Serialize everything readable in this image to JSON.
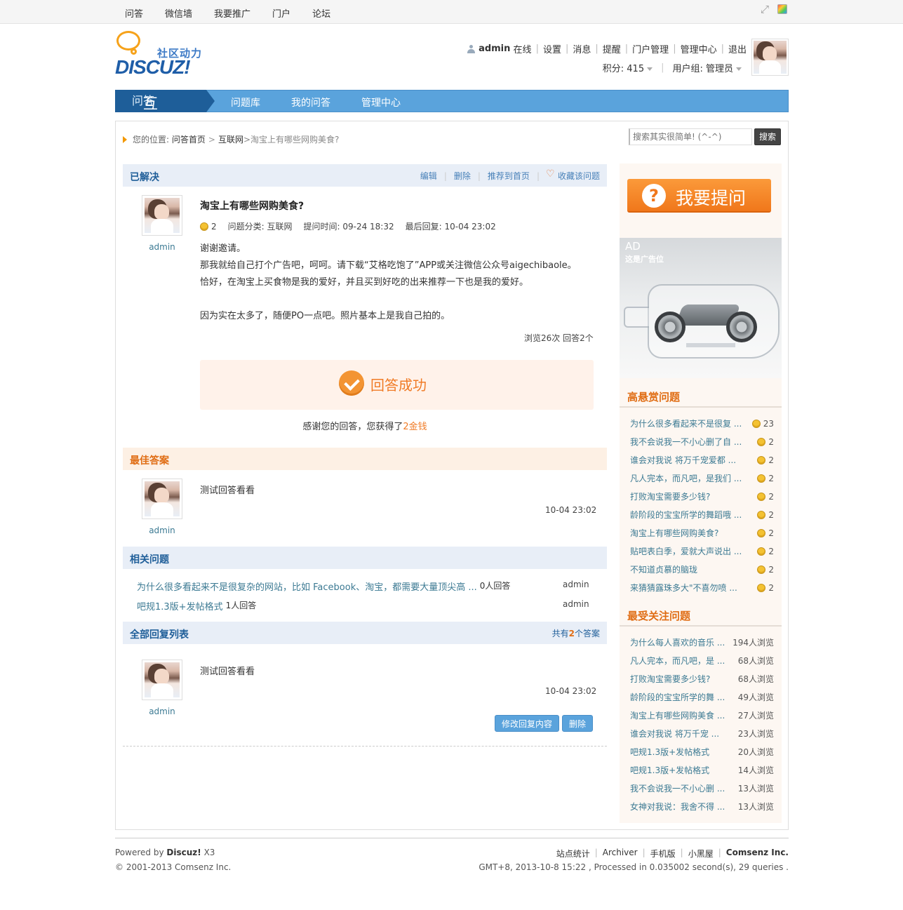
{
  "topnav": [
    "问答",
    "微信墙",
    "我要推广",
    "门户",
    "论坛"
  ],
  "logo": {
    "sub": "社区动力",
    "main": "DISCUZ!"
  },
  "user": {
    "name": "admin",
    "status": "在线",
    "links": [
      "设置",
      "消息",
      "提醒",
      "门户管理",
      "管理中心",
      "退出"
    ],
    "points": "积分: 415",
    "group": "用户组: 管理员"
  },
  "mainnav": {
    "brand": "互动",
    "brand_sub": "问答",
    "items": [
      "问题库",
      "我的问答",
      "管理中心"
    ]
  },
  "breadcrumb": {
    "label": "您的位置:",
    "home": "问答首页",
    "sep": ">",
    "cat": "互联网",
    "current": ">淘宝上有哪些网购美食?"
  },
  "search": {
    "placeholder": "搜索其实很简单! (^-^)",
    "button": "搜索"
  },
  "question": {
    "status": "已解决",
    "actions": [
      "编辑",
      "删除",
      "推荐到首页",
      "收藏该问题"
    ],
    "title": "淘宝上有哪些网购美食?",
    "reward": "2",
    "category": "问题分类: 互联网",
    "asked": "提问时间: 09-24 18:32",
    "last_reply": "最后回复: 10-04 23:02",
    "author": "admin",
    "body": [
      "谢谢邀请。",
      "那我就给自己打个广告吧，呵呵。请下载“艾格吃饱了”APP或关注微信公众号aigechibaole。",
      "恰好，在淘宝上买食物是我的爱好，并且买到好吃的出来推荐一下也是我的爱好。",
      "",
      "因为实在太多了，随便PO一点吧。照片基本上是我自己拍的。"
    ],
    "stats": "浏览26次 回答2个"
  },
  "success": {
    "text": "回答成功",
    "thanks": "感谢您的回答，您获得了",
    "gain": "2金钱"
  },
  "best": {
    "title": "最佳答案",
    "author": "admin",
    "text": "测试回答看看",
    "time": "10-04 23:02"
  },
  "related": {
    "title": "相关问题",
    "items": [
      {
        "q": "为什么很多看起来不是很复杂的网站，比如 Facebook、淘宝，都需要大量顶尖高 ...",
        "count": "0人回答",
        "author": "admin"
      },
      {
        "q": "吧规1.3版+发帖格式",
        "count": "1人回答",
        "author": "admin"
      }
    ]
  },
  "all": {
    "title": "全部回复列表",
    "count_pre": "共有",
    "count": "2",
    "count_post": "个答案",
    "author": "admin",
    "text": "测试回答看看",
    "time": "10-04 23:02",
    "btn_edit": "修改回复内容",
    "btn_delete": "删除"
  },
  "side": {
    "ask": "我要提问",
    "ad_label": "AD",
    "ad_sub": "这是广告位",
    "bounty_title": "高悬赏问题",
    "bounty": [
      {
        "q": "为什么很多看起来不是很复 ...",
        "v": "23"
      },
      {
        "q": "我不会说我一不小心删了自 ...",
        "v": "2"
      },
      {
        "q": "谁会对我说 将万千宠爱都 ...",
        "v": "2"
      },
      {
        "q": "凡人完本，而凡吧，是我们 ...",
        "v": "2"
      },
      {
        "q": "打败淘宝需要多少钱?",
        "v": "2"
      },
      {
        "q": "龄阶段的宝宝所学的舞蹈哦 ...",
        "v": "2"
      },
      {
        "q": "淘宝上有哪些网购美食?",
        "v": "2"
      },
      {
        "q": "贴吧表白季，爱就大声说出 ...",
        "v": "2"
      },
      {
        "q": "不知道贞慕的脑珑",
        "v": "2"
      },
      {
        "q": "来猜猜露珠多大\"不喜勿喷 ...",
        "v": "2"
      }
    ],
    "focus_title": "最受关注问题",
    "focus": [
      {
        "q": "为什么每人喜欢的音乐 ...",
        "v": "194人浏览"
      },
      {
        "q": "凡人完本，而凡吧，是 ...",
        "v": "68人浏览"
      },
      {
        "q": "打败淘宝需要多少钱?",
        "v": "68人浏览"
      },
      {
        "q": "龄阶段的宝宝所学的舞 ...",
        "v": "49人浏览"
      },
      {
        "q": "淘宝上有哪些网购美食 ...",
        "v": "27人浏览"
      },
      {
        "q": "谁会对我说 将万千宠 ...",
        "v": "23人浏览"
      },
      {
        "q": "吧规1.3版+发帖格式",
        "v": "20人浏览"
      },
      {
        "q": "吧规1.3版+发帖格式",
        "v": "14人浏览"
      },
      {
        "q": "我不会说我一不小心删 ...",
        "v": "13人浏览"
      },
      {
        "q": "女神对我说：我舍不得 ...",
        "v": "13人浏览"
      }
    ]
  },
  "footer": {
    "powered": "Powered by",
    "brand": "Discuz!",
    "ver": "X3",
    "copyright": "© 2001-2013 Comsenz Inc.",
    "links": [
      "站点统计",
      "Archiver",
      "手机版",
      "小黑屋"
    ],
    "company": "Comsenz Inc.",
    "stats": "GMT+8, 2013-10-8 15:22 , Processed in 0.035002 second(s), 29 queries ."
  }
}
